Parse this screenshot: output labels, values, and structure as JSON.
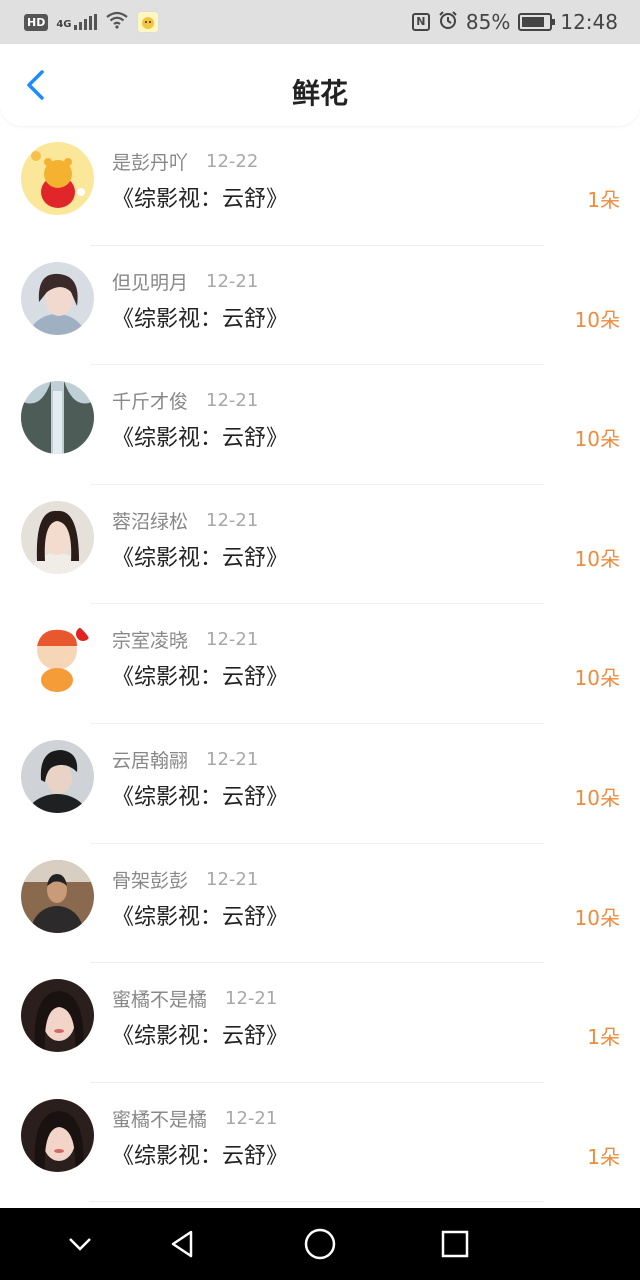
{
  "status_bar": {
    "hd": "HD",
    "network": "4G",
    "battery_percent": "85%",
    "time": "12:48",
    "nfc": "N",
    "battery_level": 0.85
  },
  "header": {
    "title": "鲜花",
    "back_icon": "chevron-left-icon"
  },
  "colors": {
    "accent": "#1a8cff",
    "count": "#f08a3c"
  },
  "records": [
    {
      "user": "是彭丹吖",
      "date": "12-22",
      "book": "《综影视：云舒》",
      "count": "1朵"
    },
    {
      "user": "但见明月",
      "date": "12-21",
      "book": "《综影视：云舒》",
      "count": "10朵"
    },
    {
      "user": "千斤才俊",
      "date": "12-21",
      "book": "《综影视：云舒》",
      "count": "10朵"
    },
    {
      "user": "蓉沼绿松",
      "date": "12-21",
      "book": "《综影视：云舒》",
      "count": "10朵"
    },
    {
      "user": "宗室凌晓",
      "date": "12-21",
      "book": "《综影视：云舒》",
      "count": "10朵"
    },
    {
      "user": "云居翰翮",
      "date": "12-21",
      "book": "《综影视：云舒》",
      "count": "10朵"
    },
    {
      "user": "骨架彭彭",
      "date": "12-21",
      "book": "《综影视：云舒》",
      "count": "10朵"
    },
    {
      "user": "蜜橘不是橘",
      "date": "12-21",
      "book": "《综影视：云舒》",
      "count": "1朵"
    },
    {
      "user": "蜜橘不是橘",
      "date": "12-21",
      "book": "《综影视：云舒》",
      "count": "1朵"
    }
  ],
  "nav": {
    "icons": [
      "chevron-down-icon",
      "back-triangle-icon",
      "home-circle-icon",
      "recents-square-icon"
    ]
  }
}
